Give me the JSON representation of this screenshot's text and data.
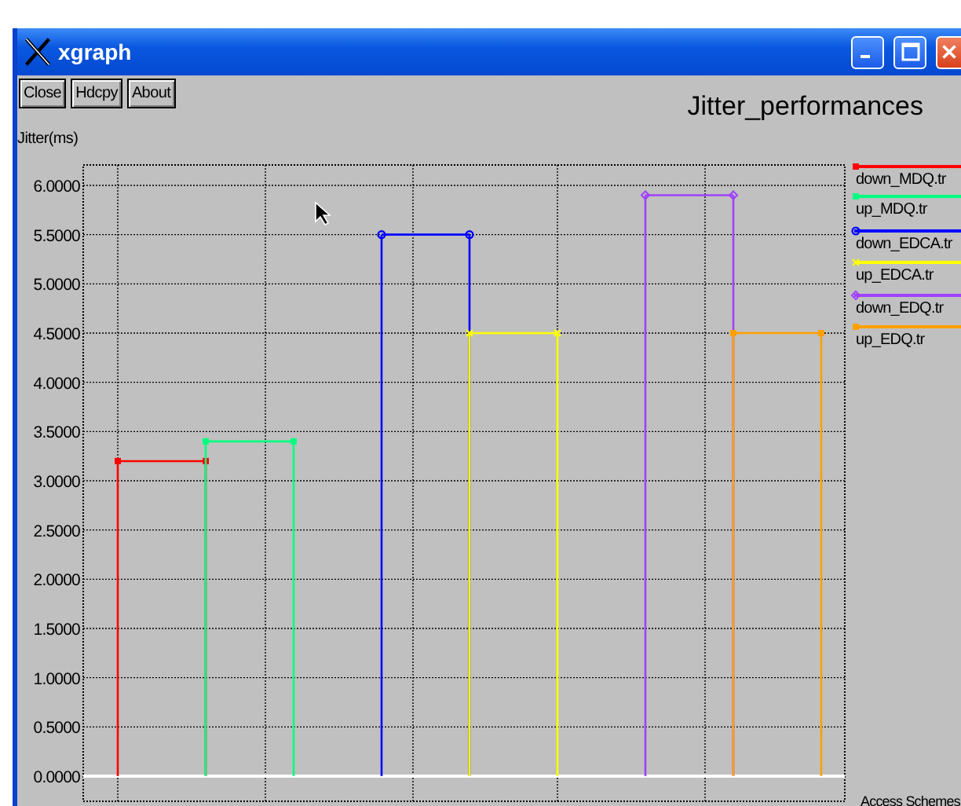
{
  "window": {
    "title": "xgraph"
  },
  "buttons": [
    "Close",
    "Hdcpy",
    "About"
  ],
  "chart_data": {
    "type": "line",
    "title": "Jitter_performances",
    "ylabel": "Jitter(ms)",
    "xlabel": "Access Schemes",
    "ylim": [
      0,
      6
    ],
    "grid": true,
    "legend": true,
    "categories": [
      null,
      null,
      null,
      null,
      null,
      null,
      null,
      null,
      null
    ],
    "yticks": [
      {
        "value": 0,
        "label": "0.0000"
      },
      {
        "value": 0.5,
        "label": "0.5000"
      },
      {
        "value": 1,
        "label": "1.0000"
      },
      {
        "value": 1.5,
        "label": "1.5000"
      },
      {
        "value": 2,
        "label": "2.0000"
      },
      {
        "value": 2.5,
        "label": "2.5000"
      },
      {
        "value": 3,
        "label": "3.0000"
      },
      {
        "value": 3.5,
        "label": "3.5000"
      },
      {
        "value": 4,
        "label": "4.0000"
      },
      {
        "value": 4.5,
        "label": "4.5000"
      },
      {
        "value": 5,
        "label": "5.0000"
      },
      {
        "value": 5.5,
        "label": "5.5000"
      },
      {
        "value": 6,
        "label": "6.0000"
      }
    ],
    "series": [
      {
        "name": "down_MDQ.tr",
        "color": "#ff0000",
        "marker": "square",
        "values": [
          3.2,
          3.2,
          null,
          null,
          null,
          null,
          null,
          null,
          null
        ]
      },
      {
        "name": "up_MDQ.tr",
        "color": "#00ff80",
        "marker": "square",
        "values": [
          null,
          3.4,
          3.4,
          null,
          null,
          null,
          null,
          null,
          null
        ]
      },
      {
        "name": "down_EDCA.tr",
        "color": "#0000ff",
        "marker": "circle",
        "values": [
          null,
          null,
          null,
          5.5,
          5.5,
          null,
          null,
          null,
          null
        ]
      },
      {
        "name": "up_EDCA.tr",
        "color": "#ffff00",
        "marker": "cross",
        "values": [
          null,
          null,
          null,
          null,
          4.5,
          4.5,
          null,
          null,
          null
        ]
      },
      {
        "name": "down_EDQ.tr",
        "color": "#a040ff",
        "marker": "diamond",
        "values": [
          null,
          null,
          null,
          null,
          null,
          null,
          5.9,
          5.9,
          null
        ]
      },
      {
        "name": "up_EDQ.tr",
        "color": "#ffa000",
        "marker": "square",
        "values": [
          null,
          null,
          null,
          null,
          null,
          null,
          null,
          4.5,
          4.5
        ]
      }
    ]
  }
}
